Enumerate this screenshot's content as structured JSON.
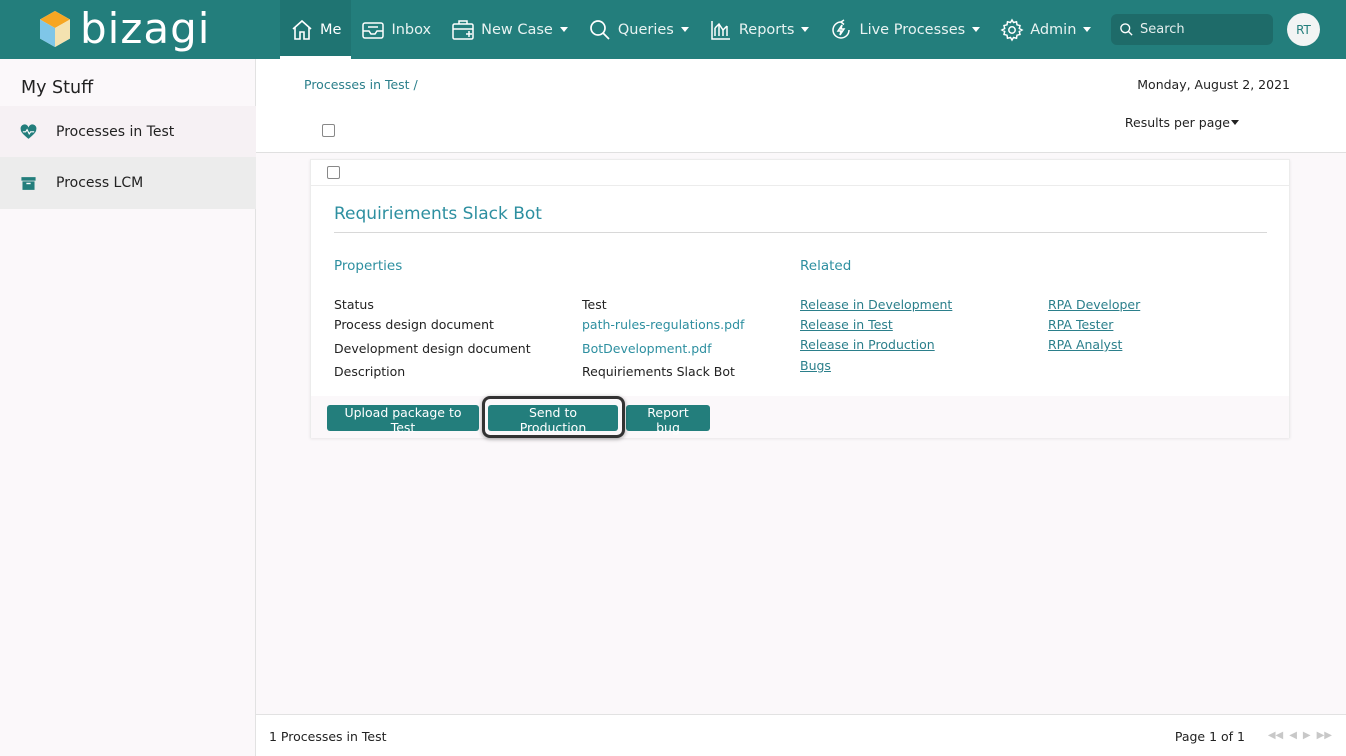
{
  "brand": {
    "name": "bizagi"
  },
  "nav": {
    "items": [
      {
        "label": "Me",
        "icon": "home-icon",
        "active": true
      },
      {
        "label": "Inbox",
        "icon": "inbox-icon"
      },
      {
        "label": "New Case",
        "icon": "new-case-icon"
      },
      {
        "label": "Queries",
        "icon": "search-icon"
      },
      {
        "label": "Reports",
        "icon": "reports-icon"
      },
      {
        "label": "Live Processes",
        "icon": "live-processes-icon"
      },
      {
        "label": "Admin",
        "icon": "gear-icon"
      }
    ],
    "search_placeholder": "Search",
    "avatar_initials": "RT"
  },
  "sidebar": {
    "title": "My Stuff",
    "items": [
      {
        "label": "Processes in Test",
        "icon": "heartbeat-icon"
      },
      {
        "label": "Process LCM",
        "icon": "archive-icon"
      }
    ]
  },
  "main": {
    "breadcrumb": "Processes in Test /",
    "date": "Monday, August 2, 2021",
    "results_per_page": "Results per page"
  },
  "case": {
    "title": "Requiriements Slack Bot",
    "properties_heading": "Properties",
    "related_heading": "Related",
    "properties": [
      {
        "label": "Status",
        "value": "Test"
      },
      {
        "label": "Process design document",
        "value": "path-rules-regulations.pdf"
      },
      {
        "label": "Development design document",
        "value": "BotDevelopment.pdf"
      },
      {
        "label": "Description",
        "value": "Requiriements Slack Bot"
      }
    ],
    "related_left": [
      "Release in Development",
      "Release in Test",
      "Release in Production",
      "Bugs"
    ],
    "related_right": [
      "RPA Developer",
      "RPA Tester",
      "RPA Analyst"
    ],
    "buttons": {
      "upload": "Upload package to Test",
      "send": "Send to Production",
      "report": "Report bug"
    }
  },
  "footer": {
    "count": "1 Processes in Test",
    "page": "Page 1 of 1"
  },
  "colors": {
    "brand": "#237e7c",
    "link": "#2d8fa0"
  }
}
